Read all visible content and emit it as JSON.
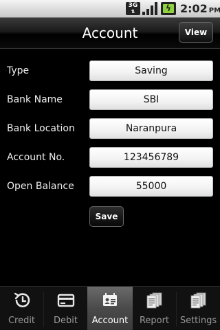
{
  "status_bar": {
    "network_label": "3G",
    "time": "2:02",
    "ampm": "PM"
  },
  "title_bar": {
    "title": "Account",
    "view_button_label": "View"
  },
  "form": {
    "fields": [
      {
        "label": "Type",
        "value": "Saving"
      },
      {
        "label": "Bank Name",
        "value": "SBI"
      },
      {
        "label": "Bank Location",
        "value": "Naranpura"
      },
      {
        "label": "Account No.",
        "value": "123456789"
      },
      {
        "label": "Open Balance",
        "value": "55000"
      }
    ],
    "save_button_label": "Save"
  },
  "tabs": [
    {
      "label": "Credit",
      "icon": "credit-icon",
      "active": false
    },
    {
      "label": "Debit",
      "icon": "debit-card-icon",
      "active": false
    },
    {
      "label": "Account",
      "icon": "account-card-icon",
      "active": true
    },
    {
      "label": "Report",
      "icon": "report-icon",
      "active": false
    },
    {
      "label": "Settings",
      "icon": "settings-icon",
      "active": false
    }
  ],
  "colors": {
    "background": "#000000",
    "active_tab": "#555555",
    "battery_green": "#8fd13f"
  }
}
